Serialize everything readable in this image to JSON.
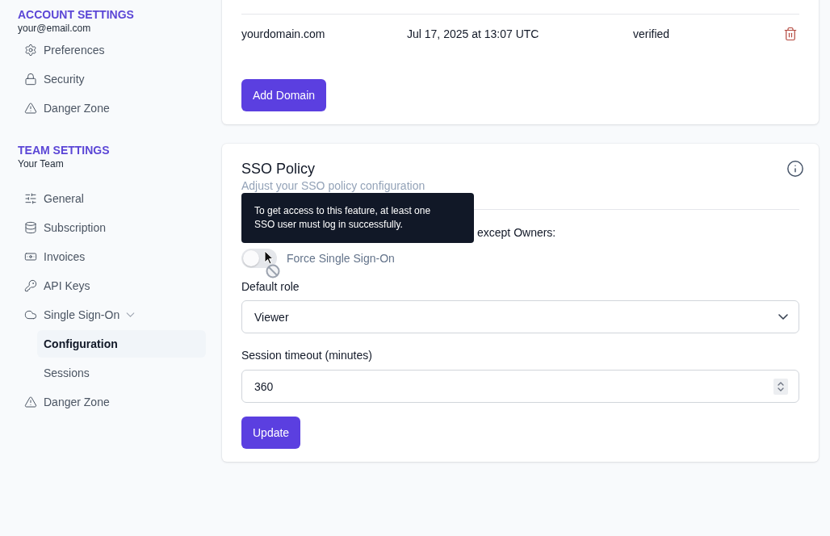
{
  "sidebar": {
    "sections": [
      {
        "title": "ACCOUNT SETTINGS",
        "subtitle": "your@email.com",
        "items": [
          {
            "label": "Preferences",
            "selected": false
          },
          {
            "label": "Security",
            "selected": false
          },
          {
            "label": "Danger Zone",
            "selected": false
          }
        ]
      },
      {
        "title": "TEAM SETTINGS",
        "subtitle": "Your Team",
        "items": [
          {
            "label": "General",
            "selected": false
          },
          {
            "label": "Subscription",
            "selected": false
          },
          {
            "label": "Invoices",
            "selected": false
          },
          {
            "label": "API Keys",
            "selected": false
          },
          {
            "label": "Single Sign-On",
            "selected": false,
            "expanded": true,
            "children": [
              {
                "label": "Configuration",
                "selected": true
              },
              {
                "label": "Sessions",
                "selected": false
              }
            ]
          },
          {
            "label": "Danger Zone",
            "selected": false
          }
        ]
      }
    ]
  },
  "domains_card": {
    "rows": [
      {
        "domain": "yourdomain.com",
        "added_at": "Jul 17, 2025 at 13:07 UTC",
        "status": "verified"
      }
    ],
    "add_button": "Add Domain"
  },
  "sso_policy": {
    "title": "SSO Policy",
    "subtitle": "Adjust your SSO policy configuration",
    "policy_text": "except Owners:",
    "tooltip": "To get access to this feature, at least one SSO user must log in successfully.",
    "toggle": {
      "label": "Force Single Sign-On",
      "on": false,
      "disabled": true
    },
    "fields": [
      {
        "kind": "select",
        "label": "Default role",
        "value": "Viewer"
      },
      {
        "kind": "number",
        "label": "Session timeout (minutes)",
        "value": "360"
      }
    ],
    "submit_button": "Update"
  }
}
